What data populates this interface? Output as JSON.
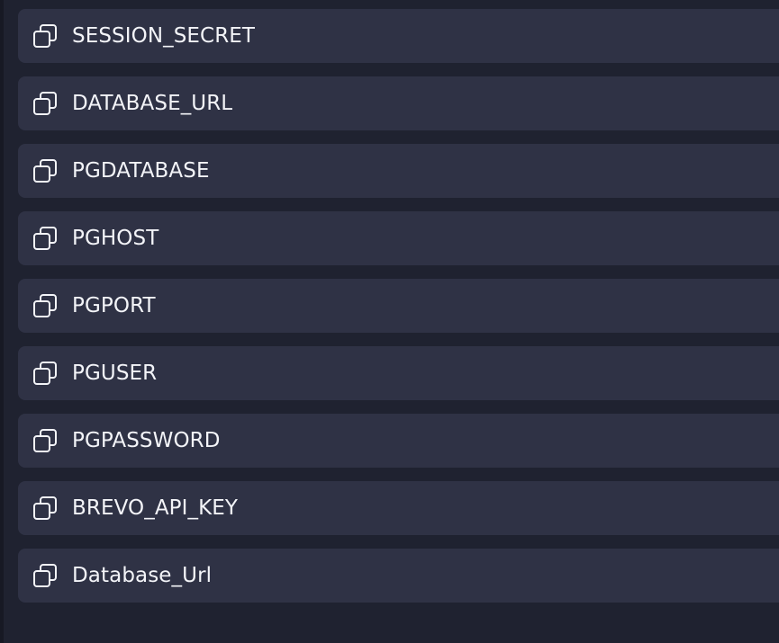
{
  "secrets": [
    {
      "key": "SESSION_SECRET",
      "icon": "copy-icon"
    },
    {
      "key": "DATABASE_URL",
      "icon": "copy-icon"
    },
    {
      "key": "PGDATABASE",
      "icon": "copy-icon"
    },
    {
      "key": "PGHOST",
      "icon": "copy-icon"
    },
    {
      "key": "PGPORT",
      "icon": "copy-icon"
    },
    {
      "key": "PGUSER",
      "icon": "copy-icon"
    },
    {
      "key": "PGPASSWORD",
      "icon": "copy-icon"
    },
    {
      "key": "BREVO_API_KEY",
      "icon": "copy-icon"
    },
    {
      "key": "Database_Url",
      "icon": "copy-icon"
    }
  ],
  "colors": {
    "background": "#1f2230",
    "row": "#2f3245",
    "text": "#f3f4f8"
  }
}
